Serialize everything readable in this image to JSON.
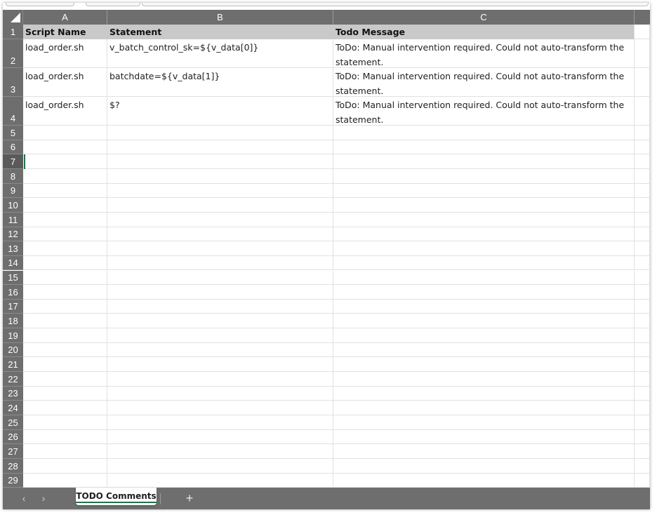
{
  "columns": [
    "A",
    "B",
    "C"
  ],
  "rows": [
    "1",
    "2",
    "3",
    "4",
    "5",
    "6",
    "7",
    "8",
    "9",
    "10",
    "11",
    "12",
    "13",
    "14",
    "15",
    "16",
    "17",
    "18",
    "19",
    "20",
    "21",
    "22",
    "23",
    "24",
    "25",
    "26",
    "27",
    "28",
    "29"
  ],
  "header": {
    "script_name": "Script Name",
    "statement": "Statement",
    "todo_message": "Todo Message"
  },
  "data_rows": [
    {
      "script": "load_order.sh",
      "statement": "v_batch_control_sk=${v_data[0]}",
      "todo": "ToDo: Manual intervention required. Could not auto-transform the statement."
    },
    {
      "script": "load_order.sh",
      "statement": "batchdate=${v_data[1]}",
      "todo": "ToDo: Manual intervention required. Could not auto-transform the statement."
    },
    {
      "script": "load_order.sh",
      "statement": "$?",
      "todo": "ToDo: Manual intervention required. Could not auto-transform the statement."
    }
  ],
  "selected_row": "7",
  "sheet_tabs": [
    {
      "label": "TODO Comments",
      "active": true
    }
  ],
  "nav": {
    "prev": "‹",
    "next": "›",
    "add": "+"
  },
  "colors": {
    "accent": "#217346",
    "header_bg": "#6e6e6e",
    "table_header": "#c9c9c9"
  }
}
